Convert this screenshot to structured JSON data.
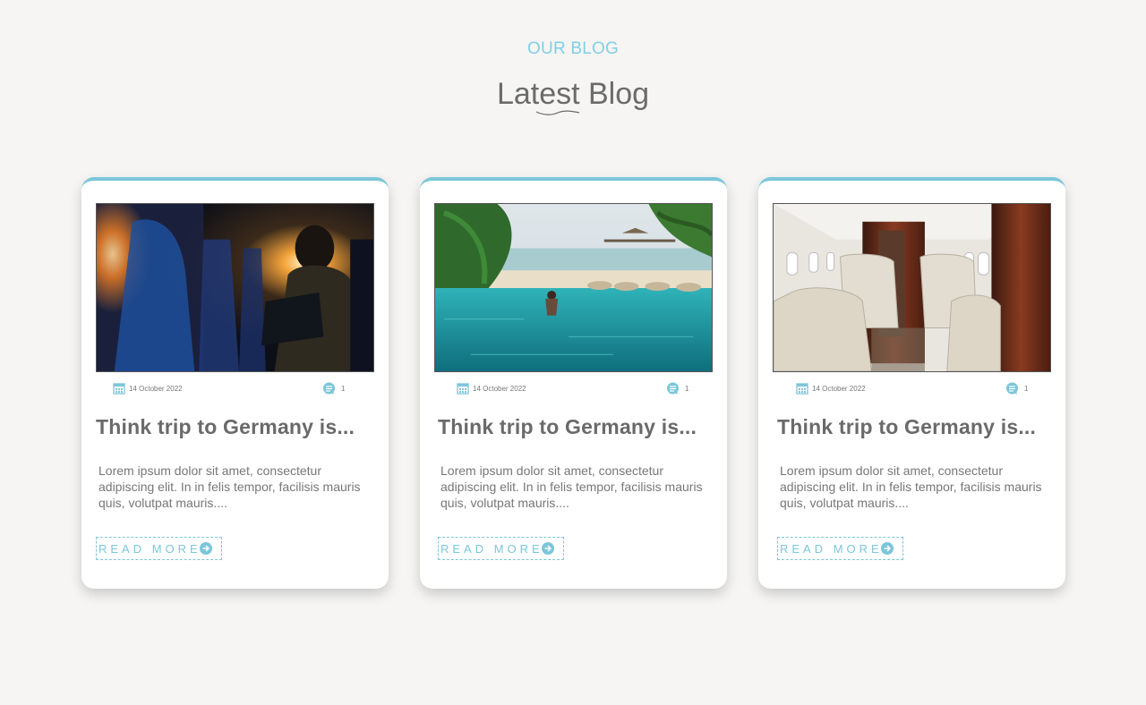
{
  "header": {
    "eyebrow": "OUR BLOG",
    "title": "Latest Blog"
  },
  "colors": {
    "accent": "#7cc6da",
    "eyebrow": "#7fd0e8",
    "background": "#f6f5f3",
    "title_text": "#6a6a6a"
  },
  "posts": [
    {
      "image": "airplane-window-traveler",
      "date": "14 October 2022",
      "comments": "1",
      "title": "Think trip to Germany is...",
      "excerpt": "Lorem ipsum dolor sit amet, consectetur adipiscing elit. In in felis tempor, facilisis mauris quis, volutpat mauris....",
      "read_more": "READ MORE"
    },
    {
      "image": "infinity-pool-beach",
      "date": "14 October 2022",
      "comments": "1",
      "title": "Think trip to Germany is...",
      "excerpt": "Lorem ipsum dolor sit amet, consectetur adipiscing elit. In in felis tempor, facilisis mauris quis, volutpat mauris....",
      "read_more": "READ MORE"
    },
    {
      "image": "private-jet-cabin",
      "date": "14 October 2022",
      "comments": "1",
      "title": "Think trip to Germany is...",
      "excerpt": "Lorem ipsum dolor sit amet, consectetur adipiscing elit. In in felis tempor, facilisis mauris quis, volutpat mauris....",
      "read_more": "READ MORE"
    }
  ],
  "icons": {
    "date": "calendar-icon",
    "comments": "comment-icon",
    "read_more": "arrow-right-circle-icon",
    "divider": "squiggle-divider"
  }
}
